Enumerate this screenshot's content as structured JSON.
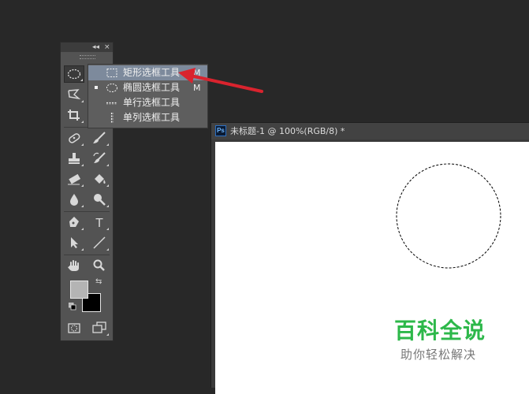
{
  "document": {
    "app_badge": "Ps",
    "title": "未标题-1 @ 100%(RGB/8) *"
  },
  "toolbox": {
    "collapse_glyph": "◂◂",
    "close_glyph": "×",
    "swap_glyph": "⇆",
    "foreground_color": "#b4b4b4",
    "background_color": "#000000",
    "tools": [
      {
        "name": "elliptical-marquee-tool",
        "icon": "ellipse-dashed-icon",
        "active": true
      },
      {
        "name": "polygonal-lasso-tool",
        "icon": "lasso-icon"
      },
      {
        "name": "crop-tool",
        "icon": "crop-icon"
      },
      {
        "name": "spot-healing-tool",
        "icon": "bandage-icon"
      },
      {
        "name": "brush-tool",
        "icon": "brush-icon"
      },
      {
        "name": "clone-stamp-tool",
        "icon": "stamp-icon"
      },
      {
        "name": "history-brush-tool",
        "icon": "history-brush-icon"
      },
      {
        "name": "eraser-tool",
        "icon": "eraser-icon"
      },
      {
        "name": "paint-bucket-tool",
        "icon": "bucket-icon"
      },
      {
        "name": "blur-tool",
        "icon": "drop-icon"
      },
      {
        "name": "dodge-tool",
        "icon": "dodge-icon"
      },
      {
        "name": "pen-tool",
        "icon": "pen-icon"
      },
      {
        "name": "type-tool",
        "icon": "type-icon"
      },
      {
        "name": "path-selection-tool",
        "icon": "arrow-cursor-icon"
      },
      {
        "name": "line-tool",
        "icon": "line-icon"
      },
      {
        "name": "hand-tool",
        "icon": "hand-icon"
      },
      {
        "name": "zoom-tool",
        "icon": "magnifier-icon"
      },
      {
        "name": "quick-mask-mode",
        "icon": "quick-mask-icon"
      },
      {
        "name": "screen-mode",
        "icon": "screen-mode-icon"
      }
    ]
  },
  "flyout": {
    "items": [
      {
        "label": "矩形选框工具",
        "shortcut": "M",
        "icon": "rect-marquee-icon",
        "highlighted": true,
        "checked": false
      },
      {
        "label": "椭圆选框工具",
        "shortcut": "M",
        "icon": "ellipse-marquee-icon",
        "highlighted": false,
        "checked": true
      },
      {
        "label": "单行选框工具",
        "shortcut": "",
        "icon": "single-row-marquee-icon",
        "highlighted": false,
        "checked": false
      },
      {
        "label": "单列选框工具",
        "shortcut": "",
        "icon": "single-column-marquee-icon",
        "highlighted": false,
        "checked": false
      }
    ]
  },
  "annotation": {
    "arrow_color": "#d9232e"
  },
  "watermark": {
    "main": "百科全说",
    "sub": "助你轻松解决",
    "main_color": "#2db84a"
  }
}
